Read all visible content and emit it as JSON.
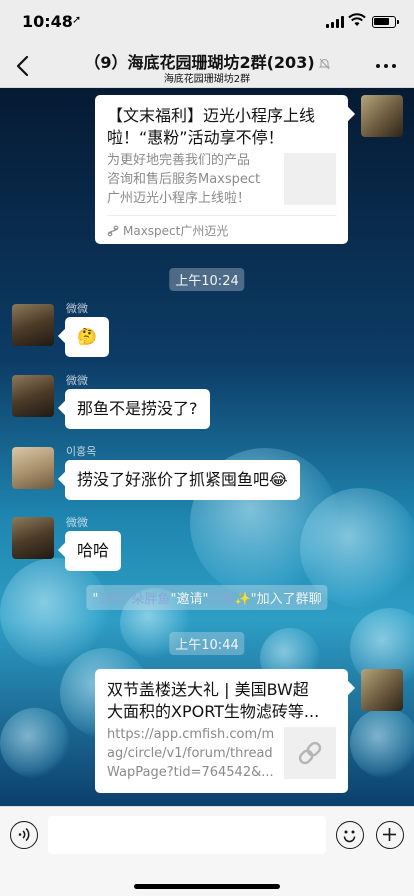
{
  "status_bar": {
    "time": "10:48",
    "location_arrow": "➚"
  },
  "nav": {
    "title": "（9）海底花园珊瑚坊2群(203)",
    "subtitle": "海底花园珊瑚坊2群",
    "back_icon": "chevron-left-icon",
    "mute_icon": "bell-off-icon",
    "more_icon": "more-icon"
  },
  "messages": {
    "card1": {
      "title_line1": "【文末福利】迈光小程序上线",
      "title_line2": "啦！“惠粉”活动享不停！",
      "desc_line1": "为更好地完善我们的产品",
      "desc_line2": "咨询和售后服务Maxspect",
      "desc_line3": "广州迈光小程序上线啦！",
      "source": "Maxspect广州迈光"
    },
    "time1": "上午10:24",
    "m1": {
      "sender": "微微",
      "text": "🤔"
    },
    "m2": {
      "sender": "微微",
      "text": "那鱼不是捞没了?"
    },
    "m3": {
      "sender": "이홍옥",
      "text": "捞没了好涨价了抓紧囤鱼吧😂"
    },
    "m4": {
      "sender": "微微",
      "text": "哈哈"
    },
    "system": {
      "q1": "\"",
      "inviter": "1997朵胖鱼",
      "mid": "\"邀请\"",
      "invitee": "小鑫",
      "sparkle": "✨",
      "tail": "\"加入了群聊"
    },
    "time2": "上午10:44",
    "card2": {
      "title_line1": "双节盖楼送大礼 | 美国BW超",
      "title_line2": "大面积的XPORT生物滤砖等...",
      "url_line1": "https://app.cmfish.com/m",
      "url_line2": "ag/circle/v1/forum/thread",
      "url_line3": "WapPage?tid=764542&..."
    }
  },
  "input_bar": {
    "voice_icon": "voice-icon",
    "emoji_icon": "emoji-icon",
    "add_icon": "plus-icon",
    "text_value": ""
  }
}
